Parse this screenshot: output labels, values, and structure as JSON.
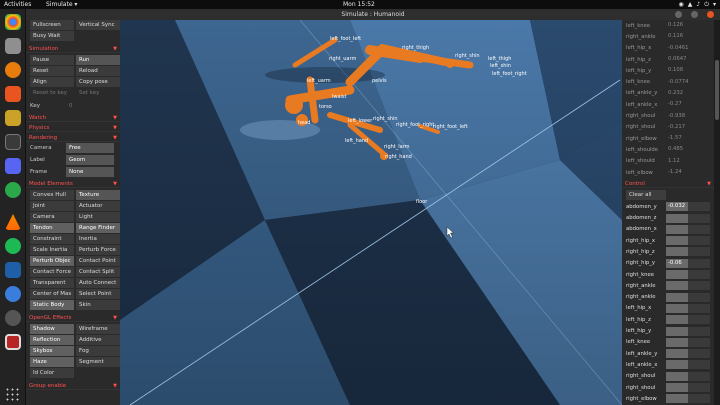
{
  "topbar": {
    "activities": "Activities",
    "app": "Simulate ▾",
    "clock": "Mon 15:52",
    "tray": [
      "◉",
      "▲",
      "♪",
      "⏻",
      "▾"
    ]
  },
  "window": {
    "title": "Simulate : Humanoid"
  },
  "left": {
    "file_buttons": [
      {
        "label": "Fullscreen",
        "state": "on"
      },
      {
        "label": "Vertical Sync",
        "state": "off"
      },
      {
        "label": "Busy Wait",
        "state": "off"
      }
    ],
    "simulation": {
      "title": "Simulation",
      "buttons": [
        {
          "label": "Pause",
          "state": "off"
        },
        {
          "label": "Run",
          "state": "on"
        },
        {
          "label": "Reset",
          "state": "off"
        },
        {
          "label": "Reload",
          "state": "off"
        },
        {
          "label": "Align",
          "state": "off"
        },
        {
          "label": "Copy pose",
          "state": "off"
        },
        {
          "label": "Reset to key",
          "state": "dis"
        },
        {
          "label": "Set key",
          "state": "dis"
        }
      ],
      "key_label": "Key",
      "key_value": "0"
    },
    "watch": {
      "title": "Watch"
    },
    "physics": {
      "title": "Physics"
    },
    "rendering": {
      "title": "Rendering",
      "rows": [
        {
          "label": "Camera",
          "value": "Free"
        },
        {
          "label": "Label",
          "value": "Geom"
        },
        {
          "label": "Frame",
          "value": "None"
        }
      ]
    },
    "model_elements": {
      "title": "Model Elements",
      "buttons": [
        {
          "label": "Convex Hull",
          "state": "off"
        },
        {
          "label": "Texture",
          "state": "on"
        },
        {
          "label": "Joint",
          "state": "off"
        },
        {
          "label": "Actuator",
          "state": "off"
        },
        {
          "label": "Camera",
          "state": "off"
        },
        {
          "label": "Light",
          "state": "off"
        },
        {
          "label": "Tendon",
          "state": "sel"
        },
        {
          "label": "Range Finder",
          "state": "sel"
        },
        {
          "label": "Constraint",
          "state": "off"
        },
        {
          "label": "Inertia",
          "state": "off"
        },
        {
          "label": "Scale Inertia",
          "state": "off"
        },
        {
          "label": "Perturb Force",
          "state": "off"
        },
        {
          "label": "Perturb Objec",
          "state": "sel"
        },
        {
          "label": "Contact Point",
          "state": "off"
        },
        {
          "label": "Contact Force",
          "state": "off"
        },
        {
          "label": "Contact Split",
          "state": "off"
        },
        {
          "label": "Transparent",
          "state": "off"
        },
        {
          "label": "Auto Connect",
          "state": "off"
        },
        {
          "label": "Center of Mas",
          "state": "off"
        },
        {
          "label": "Select Point",
          "state": "off"
        },
        {
          "label": "Static Body",
          "state": "sel"
        },
        {
          "label": "Skin",
          "state": "off"
        }
      ]
    },
    "opengl": {
      "title": "OpenGL Effects",
      "buttons": [
        {
          "label": "Shadow",
          "state": "sel"
        },
        {
          "label": "Wireframe",
          "state": "off"
        },
        {
          "label": "Reflection",
          "state": "sel"
        },
        {
          "label": "Additive",
          "state": "off"
        },
        {
          "label": "Skybox",
          "state": "sel"
        },
        {
          "label": "Fog",
          "state": "off"
        },
        {
          "label": "Haze",
          "state": "sel"
        },
        {
          "label": "Segment",
          "state": "off"
        },
        {
          "label": "Id Color",
          "state": "off"
        }
      ]
    },
    "group_enable": {
      "title": "Group enable"
    }
  },
  "right": {
    "joints": [
      {
        "name": "left_knee",
        "value": "0.126"
      },
      {
        "name": "right_ankle",
        "value": "0.116"
      },
      {
        "name": "left_hip_x",
        "value": "-0.0461"
      },
      {
        "name": "left_hip_z",
        "value": "0.0647"
      },
      {
        "name": "left_hip_y",
        "value": "0.108"
      },
      {
        "name": "left_knee",
        "value": "-0.0774"
      },
      {
        "name": "left_ankle_y",
        "value": "0.232"
      },
      {
        "name": "left_ankle_x",
        "value": "-0.27"
      },
      {
        "name": "right_shoul",
        "value": "-0.938"
      },
      {
        "name": "right_shoul",
        "value": "-0.217"
      },
      {
        "name": "right_elbow",
        "value": "-1.57"
      },
      {
        "name": "left_shoulde",
        "value": "0.485"
      },
      {
        "name": "left_should",
        "value": "1.12"
      },
      {
        "name": "left_elbow",
        "value": "-1.24"
      }
    ],
    "control": {
      "title": "Control",
      "clear_label": "Clear all",
      "rows": [
        {
          "name": "abdomen_y",
          "value": "-0.032"
        },
        {
          "name": "abdomen_z",
          "value": ""
        },
        {
          "name": "abdomen_x",
          "value": ""
        },
        {
          "name": "right_hip_x",
          "value": ""
        },
        {
          "name": "right_hip_z",
          "value": ""
        },
        {
          "name": "right_hip_y",
          "value": "-0.06"
        },
        {
          "name": "right_knee",
          "value": ""
        },
        {
          "name": "right_ankle",
          "value": ""
        },
        {
          "name": "right_ankle",
          "value": ""
        },
        {
          "name": "left_hip_x",
          "value": ""
        },
        {
          "name": "left_hip_z",
          "value": ""
        },
        {
          "name": "left_hip_y",
          "value": ""
        },
        {
          "name": "left_knee",
          "value": ""
        },
        {
          "name": "left_ankle_y",
          "value": ""
        },
        {
          "name": "left_ankle_x",
          "value": ""
        },
        {
          "name": "right_shoul",
          "value": ""
        },
        {
          "name": "right_shoul",
          "value": ""
        },
        {
          "name": "right_elbow",
          "value": ""
        }
      ]
    }
  },
  "viewport": {
    "floor_label": "floor",
    "labels": [
      "right_thigh",
      "right_shin",
      "left_thigh",
      "left_shin",
      "left_foot_right",
      "left_foot_left",
      "right_uarm",
      "left_uarm",
      "lwaist",
      "torso",
      "pelvis",
      "head",
      "right_shin",
      "right_foot_right",
      "right_foot_left",
      "right_hand",
      "left_lower",
      "left_hand",
      "right_larm"
    ]
  },
  "colors": {
    "panel": "#2a2a2a",
    "section_title": "#ff5151",
    "floor_light": "#4a78a8",
    "floor_dark": "#20354f",
    "body": "#e87a22"
  }
}
